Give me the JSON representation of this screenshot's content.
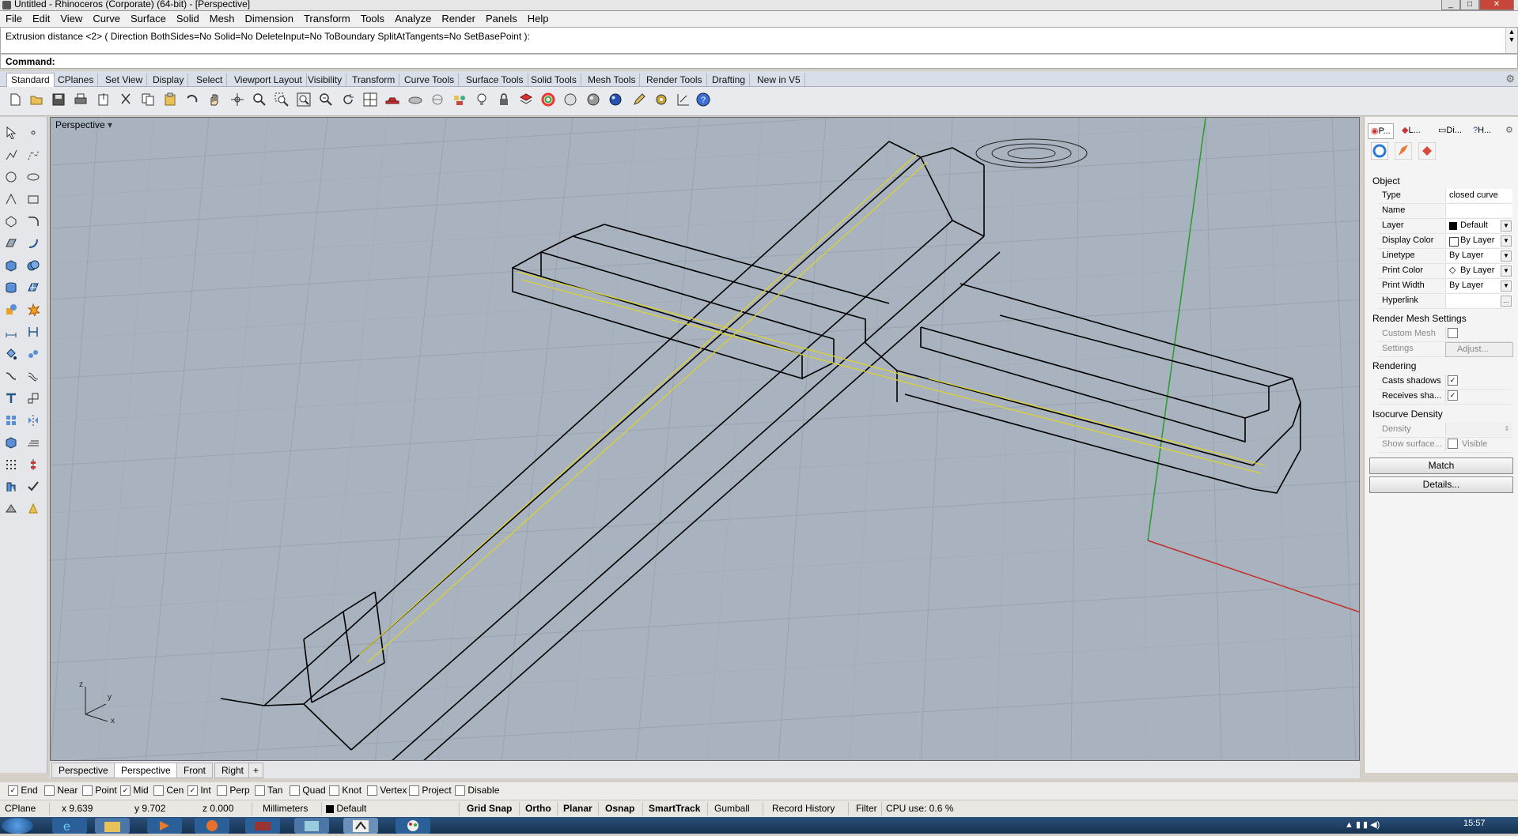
{
  "window": {
    "title": "Untitled - Rhinoceros (Corporate) (64-bit) - [Perspective]"
  },
  "menu": [
    "File",
    "Edit",
    "View",
    "Curve",
    "Surface",
    "Solid",
    "Mesh",
    "Dimension",
    "Transform",
    "Tools",
    "Analyze",
    "Render",
    "Panels",
    "Help"
  ],
  "command": {
    "history": "Extrusion distance <2> ( Direction  BothSides=No  Solid=No  DeleteInput=No  ToBoundary  SplitAtTangents=No  SetBasePoint ):",
    "prompt_label": "Command:",
    "value": ""
  },
  "toolbar_tabs": [
    "Standard",
    "CPlanes",
    "Set View",
    "Display",
    "Select",
    "Viewport Layout",
    "Visibility",
    "Transform",
    "Curve Tools",
    "Surface Tools",
    "Solid Tools",
    "Mesh Tools",
    "Render Tools",
    "Drafting",
    "New in V5"
  ],
  "toolbar_icons": [
    "new-icon",
    "open-icon",
    "save-icon",
    "print-icon",
    "import-icon",
    "cut-icon",
    "copy-icon",
    "paste-icon",
    "undo-icon",
    "pan-icon",
    "rotate-view-icon",
    "zoom-icon",
    "zoom-window-icon",
    "zoom-extents-icon",
    "zoom-selected-icon",
    "rotate-icon",
    "four-viewports-icon",
    "car-icon",
    "render-icon",
    "ghosted-icon",
    "filter-icon",
    "light-icon",
    "lock-icon",
    "layer-icon",
    "color-wheel-icon",
    "sphere-icon",
    "shaded-sphere-icon",
    "rendered-sphere-icon",
    "pen-icon",
    "settings-icon",
    "dimension-icon",
    "help-icon"
  ],
  "viewport": {
    "title": "Perspective",
    "tabs": [
      "Perspective",
      "Perspective",
      "Front",
      "Right"
    ],
    "active_tab": 1,
    "axes": {
      "z": "z",
      "y": "y",
      "x": "x"
    }
  },
  "panel": {
    "tabs": [
      "P...",
      "L...",
      "Di...",
      "H..."
    ],
    "object_section": "Object",
    "rows": [
      {
        "key": "Type",
        "value": "closed curve"
      },
      {
        "key": "Name",
        "value": ""
      },
      {
        "key": "Layer",
        "value": "Default"
      },
      {
        "key": "Display Color",
        "value": "By Layer"
      },
      {
        "key": "Linetype",
        "value": "By Layer"
      },
      {
        "key": "Print Color",
        "value": "By Layer"
      },
      {
        "key": "Print Width",
        "value": "By Layer"
      },
      {
        "key": "Hyperlink",
        "value": ""
      }
    ],
    "render_mesh_section": "Render Mesh Settings",
    "custom_mesh_label": "Custom Mesh",
    "settings_label": "Settings",
    "adjust_label": "Adjust...",
    "rendering_section": "Rendering",
    "casts_shadows_label": "Casts shadows",
    "receives_shadows_label": "Receives sha...",
    "isocurve_section": "Isocurve Density",
    "density_label": "Density",
    "show_surface_label": "Show surface...",
    "visible_label": "Visible",
    "match_label": "Match",
    "details_label": "Details...",
    "colors": {
      "layer_swatch": "#000000"
    }
  },
  "osnaps": [
    {
      "label": "End",
      "checked": true
    },
    {
      "label": "Near",
      "checked": false
    },
    {
      "label": "Point",
      "checked": false
    },
    {
      "label": "Mid",
      "checked": true
    },
    {
      "label": "Cen",
      "checked": false
    },
    {
      "label": "Int",
      "checked": true
    },
    {
      "label": "Perp",
      "checked": false
    },
    {
      "label": "Tan",
      "checked": false
    },
    {
      "label": "Quad",
      "checked": false
    },
    {
      "label": "Knot",
      "checked": false
    },
    {
      "label": "Vertex",
      "checked": false
    },
    {
      "label": "Project",
      "checked": false
    },
    {
      "label": "Disable",
      "checked": false
    }
  ],
  "status": {
    "cplane": "CPlane",
    "x": "x 9.639",
    "y": "y 9.702",
    "z": "z 0.000",
    "units": "Millimeters",
    "layer": "Default",
    "grid_snap": "Grid Snap",
    "ortho": "Ortho",
    "planar": "Planar",
    "osnap": "Osnap",
    "smarttrack": "SmartTrack",
    "gumball": "Gumball",
    "record_history": "Record History",
    "filter": "Filter",
    "cpu": "CPU use: 0.6 %"
  },
  "taskbar": {
    "clock": "15:57"
  }
}
